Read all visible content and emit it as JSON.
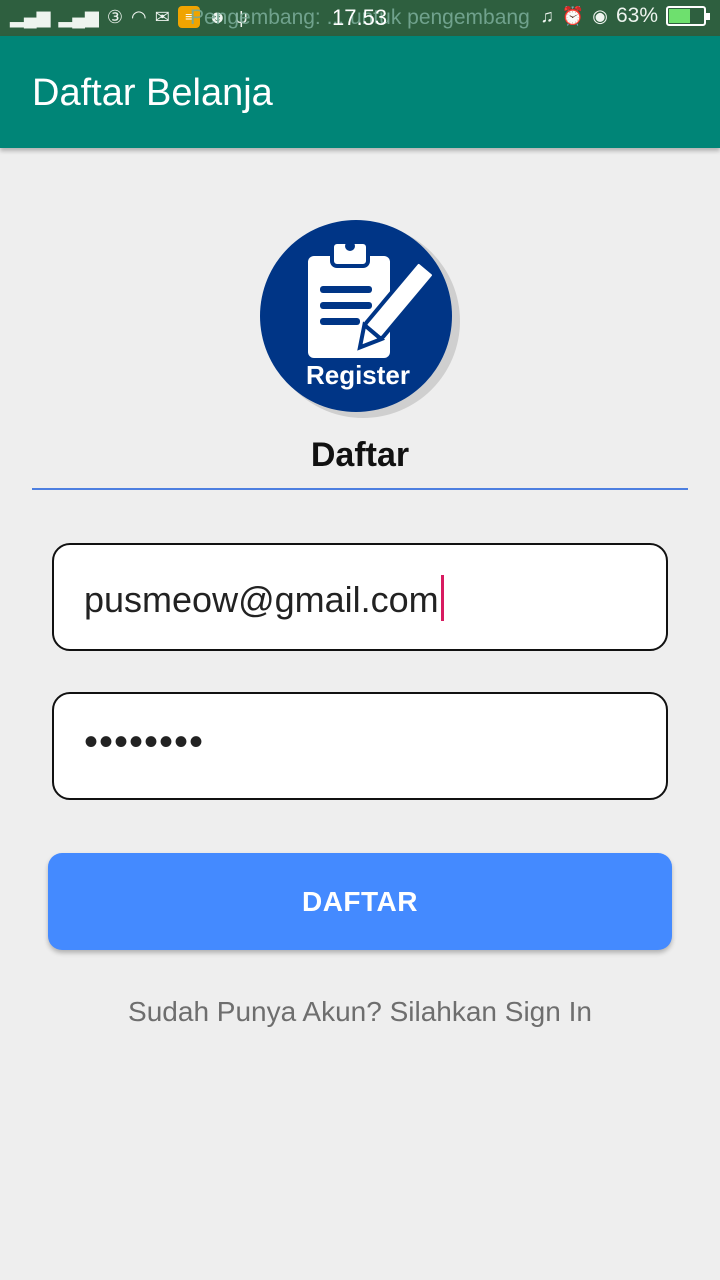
{
  "status_bar": {
    "ticker": "Pengembang: ... untuk pengembang",
    "time": "17.53",
    "battery": "63%",
    "battery_level": 0.63,
    "battery_color": "#6ee06e"
  },
  "app_bar": {
    "title": "Daftar Belanja",
    "color": "#008577"
  },
  "logo": {
    "label": "Register",
    "icon": "clipboard-pencil-icon",
    "color": "#003586"
  },
  "form": {
    "heading": "Daftar",
    "email_value": "pusmeow@gmail.com",
    "password_value": "••••••••",
    "submit_label": "DAFTAR",
    "submit_color": "#448aff",
    "signin_text": "Sudah Punya Akun? Silahkan Sign In"
  }
}
